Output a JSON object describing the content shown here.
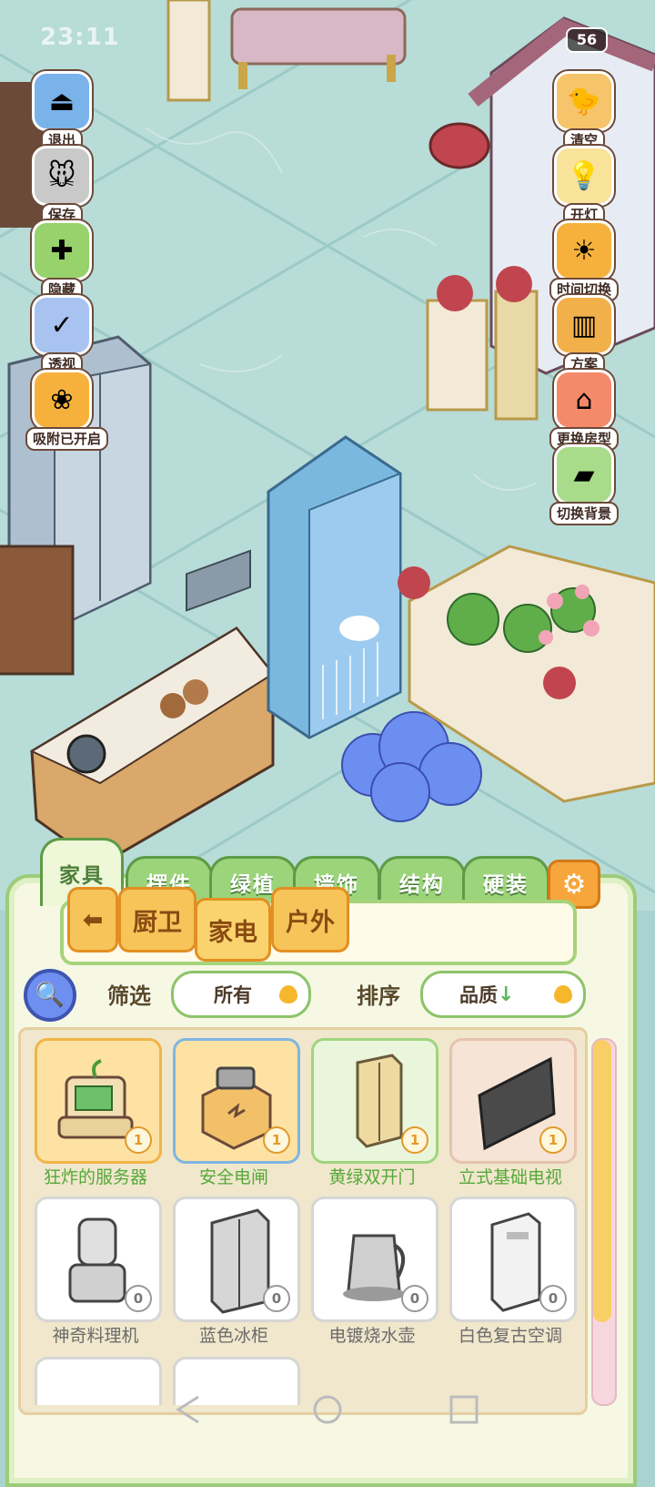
{
  "status": {
    "time": "23:11",
    "battery": "56"
  },
  "left_tools": [
    {
      "label": "退出",
      "icon": "exit-icon"
    },
    {
      "label": "保存",
      "icon": "save-icon"
    },
    {
      "label": "隐藏",
      "icon": "hide-icon"
    },
    {
      "label": "透视",
      "icon": "perspective-icon"
    },
    {
      "label": "吸附已开启",
      "icon": "snap-icon"
    }
  ],
  "right_tools": [
    {
      "label": "清空",
      "icon": "clear-icon"
    },
    {
      "label": "开灯",
      "icon": "light-icon"
    },
    {
      "label": "时间切换",
      "icon": "time-switch-icon"
    },
    {
      "label": "方案",
      "icon": "plan-icon"
    },
    {
      "label": "更换房型",
      "icon": "house-icon"
    },
    {
      "label": "切换背景",
      "icon": "background-icon"
    }
  ],
  "tabs": [
    "家具",
    "摆件",
    "绿植",
    "墙饰",
    "结构",
    "硬装"
  ],
  "active_tab": "家具",
  "categories": [
    "厨卫",
    "家电",
    "户外"
  ],
  "active_category": "家电",
  "filter": {
    "label": "筛选",
    "value": "所有"
  },
  "sort": {
    "label": "排序",
    "value": "品质",
    "arrow": "↓"
  },
  "items": [
    {
      "name": "狂炸的服务器",
      "qty": "1"
    },
    {
      "name": "安全电闸",
      "qty": "1"
    },
    {
      "name": "黄绿双开门",
      "qty": "1"
    },
    {
      "name": "立式基础电视",
      "qty": "1"
    },
    {
      "name": "神奇料理机",
      "qty": "0"
    },
    {
      "name": "蓝色冰柜",
      "qty": "0"
    },
    {
      "name": "电镀烧水壶",
      "qty": "0"
    },
    {
      "name": "白色复古空调",
      "qty": "0"
    }
  ],
  "colors": {
    "accent_green": "#9bd47a",
    "accent_orange": "#f7c45a",
    "panel_bg": "#f6f8e4"
  }
}
